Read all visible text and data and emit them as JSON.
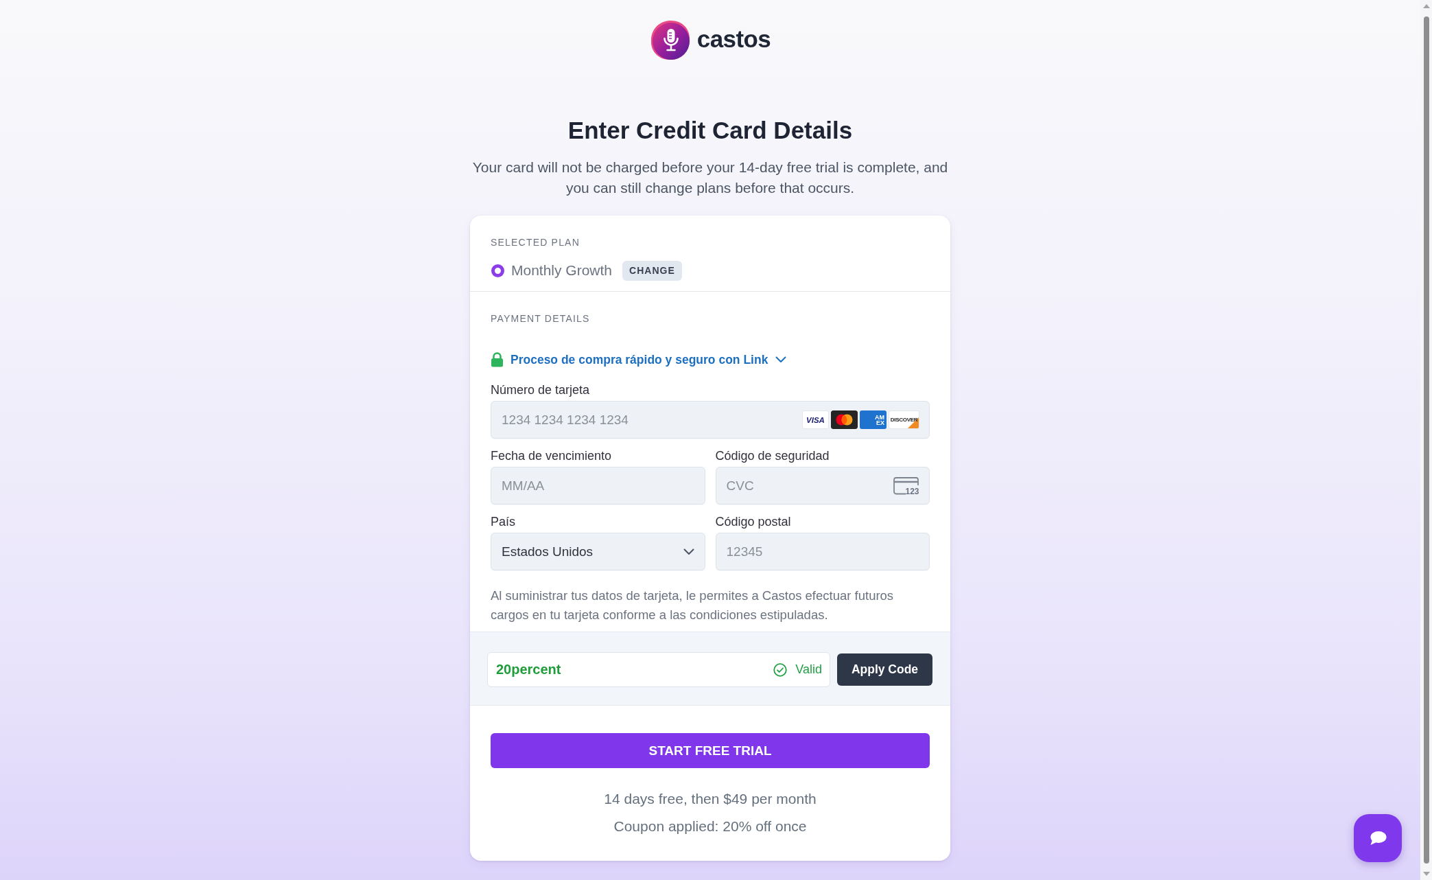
{
  "logo": {
    "name": "castos"
  },
  "heading": "Enter Credit Card Details",
  "subheading": "Your card will not be charged before your 14-day free trial is complete, and you can still change plans before that occurs.",
  "selected_plan": {
    "label": "SELECTED PLAN",
    "plan": {
      "name": "Monthly Growth",
      "selected": true
    },
    "change_button": "CHANGE"
  },
  "payment_details": {
    "label": "PAYMENT DETAILS",
    "link_checkout": "Proceso de compra rápido y seguro con Link",
    "fields": [
      {
        "kind": "card",
        "label": "Número de tarjeta",
        "placeholder": "1234 1234 1234 1234",
        "brands": [
          {
            "kind": "visa",
            "label": "VISA"
          },
          {
            "kind": "mastercard"
          },
          {
            "kind": "amex",
            "label": "AM EX"
          },
          {
            "kind": "discover",
            "label": "DISCOVER"
          }
        ]
      },
      {
        "kind": "text",
        "label": "Fecha de vencimiento",
        "placeholder": "MM/AA"
      },
      {
        "kind": "cvc",
        "label": "Código de seguridad",
        "placeholder": "CVC",
        "icon_text": "123"
      },
      {
        "kind": "select",
        "label": "País",
        "value": "Estados Unidos"
      },
      {
        "kind": "text",
        "label": "Código postal",
        "placeholder": "12345"
      }
    ],
    "disclaimer": "Al suministrar tus datos de tarjeta, le permites a Castos efectuar futuros cargos en tu tarjeta conforme a las condiciones estipuladas."
  },
  "coupon": {
    "code": "20percent",
    "valid": true,
    "status": "Valid",
    "apply_button": "Apply Code"
  },
  "submit_button": "START FREE TRIAL",
  "summary": [
    "14 days free, then $49 per month",
    "Coupon applied: 20% off once"
  ]
}
